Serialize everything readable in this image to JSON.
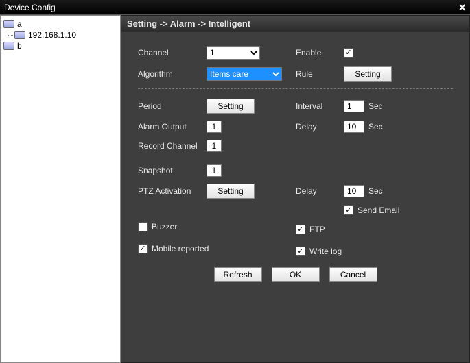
{
  "window": {
    "title": "Device Config"
  },
  "tree": {
    "items": [
      {
        "label": "a"
      },
      {
        "label": "192.168.1.10"
      },
      {
        "label": "b"
      }
    ]
  },
  "breadcrumb": "Setting -> Alarm -> Intelligent",
  "labels": {
    "channel": "Channel",
    "enable": "Enable",
    "algorithm": "Algorithm",
    "rule": "Rule",
    "period": "Period",
    "interval": "Interval",
    "alarm_output": "Alarm Output",
    "delay": "Delay",
    "record_channel": "Record Channel",
    "snapshot": "Snapshot",
    "ptz_activation": "PTZ Activation",
    "send_email": "Send Email",
    "buzzer": "Buzzer",
    "ftp": "FTP",
    "mobile_reported": "Mobile reported",
    "write_log": "Write log",
    "sec": "Sec"
  },
  "values": {
    "channel": "1",
    "algorithm": "Items care",
    "interval": "1",
    "delay1": "10",
    "alarm_output": "1",
    "record_channel": "1",
    "snapshot": "1",
    "delay2": "10"
  },
  "buttons": {
    "setting": "Setting",
    "refresh": "Refresh",
    "ok": "OK",
    "cancel": "Cancel"
  },
  "checks": {
    "enable": true,
    "send_email": true,
    "buzzer": false,
    "ftp": true,
    "mobile_reported": true,
    "write_log": true
  }
}
